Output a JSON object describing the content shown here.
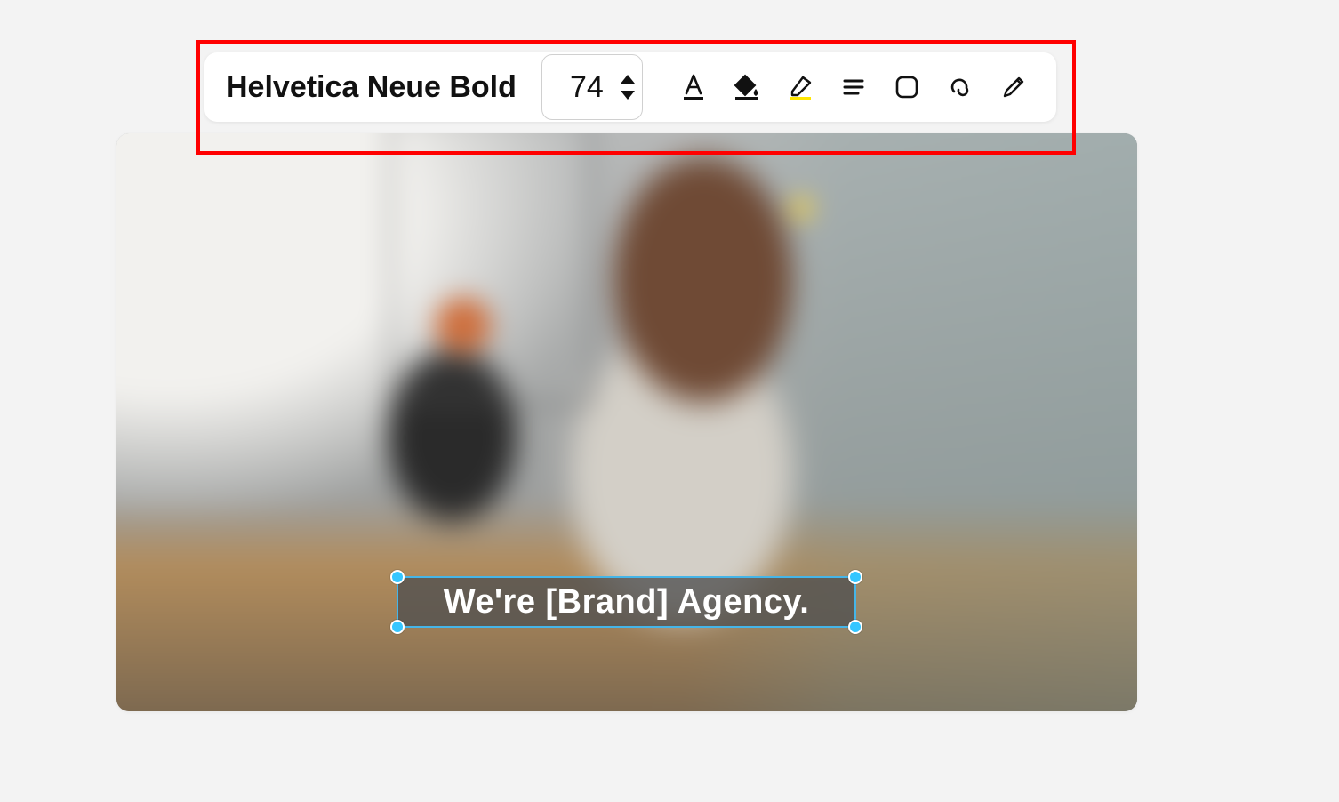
{
  "toolbar": {
    "font_name": "Helvetica Neue Bold",
    "font_size": "74",
    "icons": {
      "text_color": "text-color-icon",
      "fill_color": "fill-color-icon",
      "highlight": "highlight-icon",
      "align": "align-icon",
      "layer": "layer-icon",
      "effects": "effects-icon",
      "edit": "edit-icon"
    },
    "highlight_color": "#ffe600"
  },
  "canvas": {
    "selected_text": "We're [Brand] Agency.",
    "selection_color": "#45b5e8",
    "handle_color": "#34c6ff"
  },
  "annotation": {
    "box_color": "#ff0000"
  }
}
